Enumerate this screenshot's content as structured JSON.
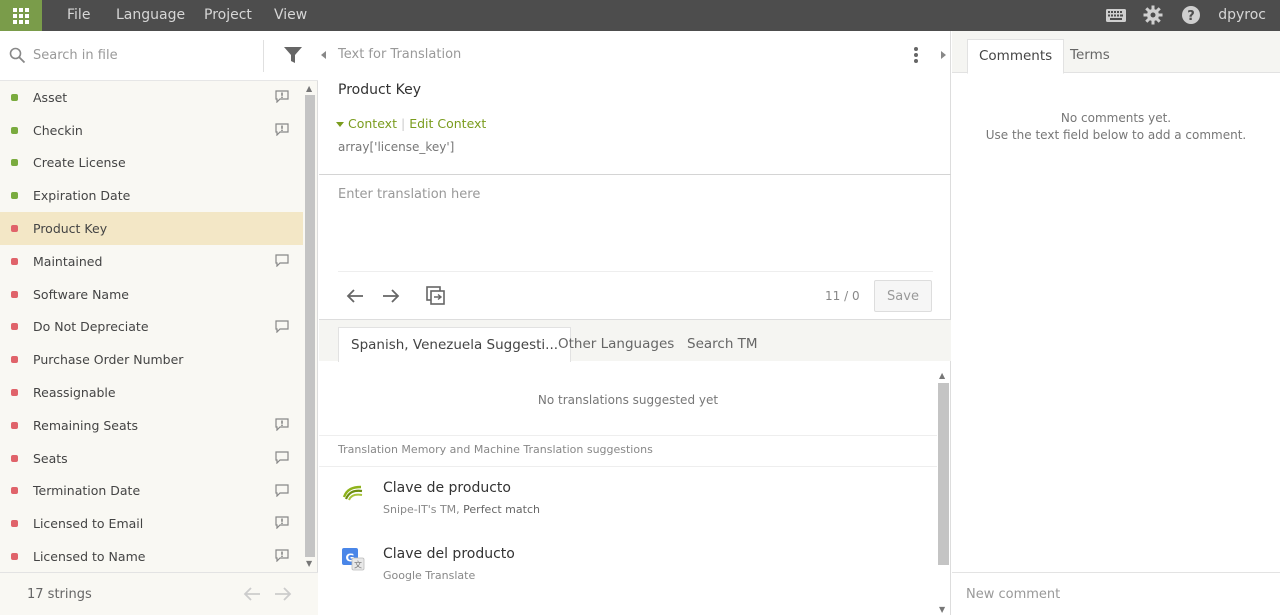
{
  "topbar": {
    "menu": [
      "File",
      "Language",
      "Project",
      "View"
    ],
    "username": "dpyroc",
    "icons": [
      "apps-grid-icon",
      "keyboard-icon",
      "gear-icon",
      "help-icon"
    ],
    "accent": "#7a9c4a"
  },
  "left": {
    "search_placeholder": "Search in file",
    "strings": [
      {
        "label": "Asset",
        "status": "translated",
        "comment_icon": "comment-issue"
      },
      {
        "label": "Checkin",
        "status": "translated",
        "comment_icon": "comment-issue"
      },
      {
        "label": "Create License",
        "status": "translated",
        "comment_icon": ""
      },
      {
        "label": "Expiration Date",
        "status": "translated",
        "comment_icon": ""
      },
      {
        "label": "Product Key",
        "status": "untranslated",
        "comment_icon": "",
        "selected": true
      },
      {
        "label": "Maintained",
        "status": "untranslated",
        "comment_icon": "comment"
      },
      {
        "label": "Software Name",
        "status": "untranslated",
        "comment_icon": ""
      },
      {
        "label": "Do Not Depreciate",
        "status": "untranslated",
        "comment_icon": "comment"
      },
      {
        "label": "Purchase Order Number",
        "status": "untranslated",
        "comment_icon": ""
      },
      {
        "label": "Reassignable",
        "status": "untranslated",
        "comment_icon": ""
      },
      {
        "label": "Remaining Seats",
        "status": "untranslated",
        "comment_icon": "comment-issue"
      },
      {
        "label": "Seats",
        "status": "untranslated",
        "comment_icon": "comment"
      },
      {
        "label": "Termination Date",
        "status": "untranslated",
        "comment_icon": "comment"
      },
      {
        "label": "Licensed to Email",
        "status": "untranslated",
        "comment_icon": "comment-issue"
      },
      {
        "label": "Licensed to Name",
        "status": "untranslated",
        "comment_icon": "comment-issue"
      }
    ],
    "footer_count": "17 strings",
    "status_colors": {
      "translated": "#7aab3e",
      "untranslated": "#e0636a"
    }
  },
  "middle": {
    "header": "Text for Translation",
    "source_text": "Product Key",
    "context_label": "Context",
    "edit_context_label": "Edit Context",
    "context_value": "array['license_key']",
    "translation_placeholder": "Enter translation here",
    "counter": "11 / 0",
    "save_label": "Save",
    "tabs": [
      "Spanish, Venezuela Suggesti...",
      "Other Languages",
      "Search TM"
    ],
    "no_suggestions": "No translations suggested yet",
    "tm_header": "Translation Memory and Machine Translation suggestions",
    "suggestions": [
      {
        "text": "Clave de producto",
        "source": "Snipe-IT's TM,",
        "match": "Perfect match",
        "icon": "tm-icon"
      },
      {
        "text": "Clave del producto",
        "source": "Google Translate",
        "match": "",
        "icon": "google-translate-icon"
      }
    ]
  },
  "right": {
    "tabs": [
      "Comments",
      "Terms"
    ],
    "empty_line1": "No comments yet.",
    "empty_line2": "Use the text field below to add a comment.",
    "comment_placeholder": "New comment"
  }
}
